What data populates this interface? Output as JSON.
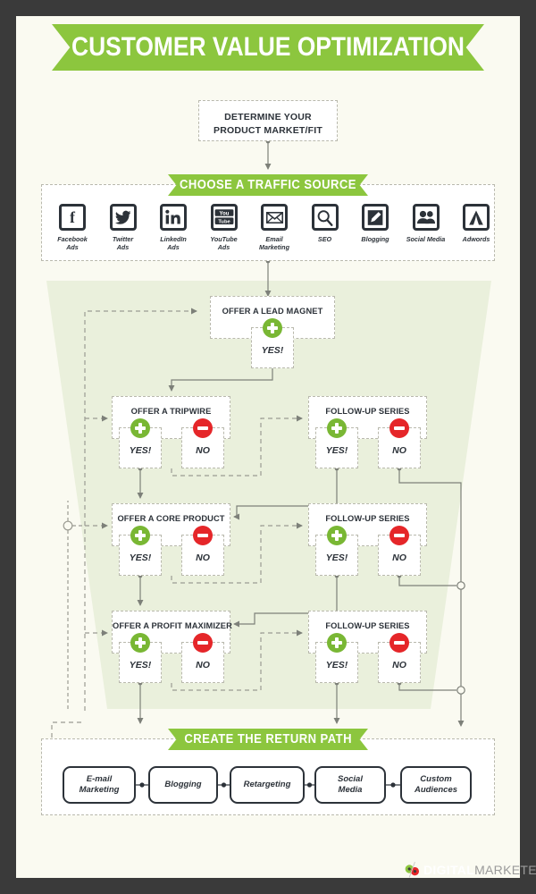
{
  "page": {
    "title_banner": "CUSTOMER VALUE OPTIMIZATION",
    "frame_color": "#3a3a3a",
    "canvas_color": "#fafaf1",
    "brand_green": "#8cc63e",
    "positive_green": "#79b734",
    "negative_red": "#e52629",
    "ink": "#2c3239",
    "backdrop_green": "#eaf0dc"
  },
  "steps": {
    "determine": {
      "line1": "DETERMINE YOUR",
      "line2": "PRODUCT MARKET/FIT"
    }
  },
  "traffic": {
    "banner": "CHOOSE A TRAFFIC SOURCE",
    "sources": [
      {
        "icon": "facebook-icon",
        "line1": "Facebook",
        "line2": "Ads"
      },
      {
        "icon": "twitter-icon",
        "line1": "Twitter",
        "line2": "Ads"
      },
      {
        "icon": "linkedin-icon",
        "line1": "LinkedIn",
        "line2": "Ads"
      },
      {
        "icon": "youtube-icon",
        "line1": "YouTube",
        "line2": "Ads"
      },
      {
        "icon": "envelope-icon",
        "line1": "Email",
        "line2": "Marketing"
      },
      {
        "icon": "magnifier-icon",
        "line1": "SEO",
        "line2": ""
      },
      {
        "icon": "pencil-square-icon",
        "line1": "Blogging",
        "line2": ""
      },
      {
        "icon": "people-icon",
        "line1": "Social Media",
        "line2": ""
      },
      {
        "icon": "adwords-icon",
        "line1": "Adwords",
        "line2": ""
      }
    ]
  },
  "funnel": {
    "lead_magnet": {
      "title": "OFFER A LEAD MAGNET",
      "yes": "YES!"
    },
    "tripwire": {
      "title": "OFFER A TRIPWIRE",
      "yes": "YES!",
      "no": "NO"
    },
    "core_product": {
      "title": "OFFER A CORE PRODUCT",
      "yes": "YES!",
      "no": "NO"
    },
    "profit_maximizer": {
      "title": "OFFER A PROFIT MAXIMIZER",
      "yes": "YES!",
      "no": "NO"
    },
    "follow_up_1": {
      "title": "FOLLOW-UP SERIES",
      "yes": "YES!",
      "no": "NO"
    },
    "follow_up_2": {
      "title": "FOLLOW-UP SERIES",
      "yes": "YES!",
      "no": "NO"
    },
    "follow_up_3": {
      "title": "FOLLOW-UP SERIES",
      "yes": "YES!",
      "no": "NO"
    }
  },
  "return_path": {
    "banner": "CREATE THE RETURN PATH",
    "items": [
      {
        "line1": "E-mail",
        "line2": "Marketing"
      },
      {
        "line1": "Blogging",
        "line2": ""
      },
      {
        "line1": "Retargeting",
        "line2": ""
      },
      {
        "line1": "Social",
        "line2": "Media"
      },
      {
        "line1": "Custom",
        "line2": "Audiences"
      }
    ]
  },
  "footer": {
    "logo_bold": "DIGITAL",
    "logo_light": "MARKETER"
  }
}
